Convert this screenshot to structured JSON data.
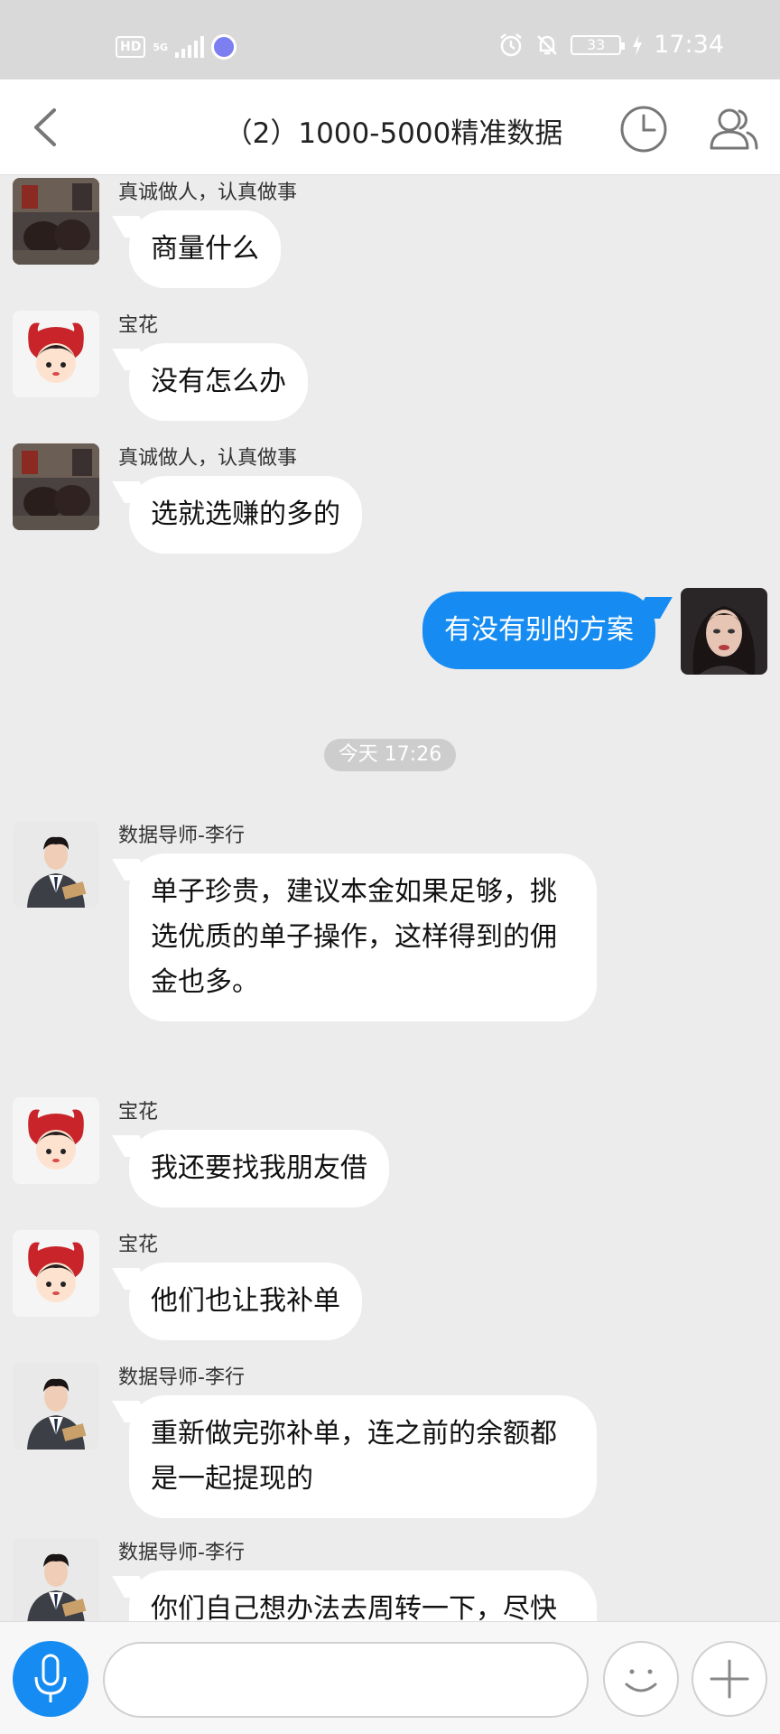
{
  "status_bar": {
    "hd": "HD",
    "network": "5G",
    "battery": "33",
    "time": "17:34"
  },
  "header": {
    "title": "（2）1000-5000精准数据"
  },
  "messages": [
    {
      "sender": "真诚做人，认真做事",
      "text": "商量什么"
    },
    {
      "sender": "宝花",
      "text": "没有怎么办"
    },
    {
      "sender": "真诚做人，认真做事",
      "text": "选就选赚的多的"
    },
    {
      "text": "有没有别的方案"
    },
    {
      "sender": "数据导师-李行",
      "text": "单子珍贵，建议本金如果足够，挑选优质的单子操作，这样得到的佣金也多。"
    },
    {
      "sender": "宝花",
      "text": "我还要找我朋友借"
    },
    {
      "sender": "宝花",
      "text": "他们也让我补单"
    },
    {
      "sender": "数据导师-李行",
      "text": "重新做完弥补单，连之前的余额都是一起提现的"
    },
    {
      "sender": "数据导师-李行",
      "text": "你们自己想办法去周转一下，尽快把任务完成后，提现。"
    }
  ],
  "time_divider": {
    "day": "今天",
    "time": "17:26"
  },
  "input_bar": {
    "placeholder": ""
  },
  "colors": {
    "accent": "#168cf2",
    "background": "#ececec",
    "time_pill": "#cdcdcd"
  },
  "icons": [
    "back-arrow-icon",
    "clock-icon",
    "members-icon",
    "microphone-icon",
    "smiley-icon",
    "plus-icon",
    "alarm-icon",
    "mute-bell-icon"
  ]
}
